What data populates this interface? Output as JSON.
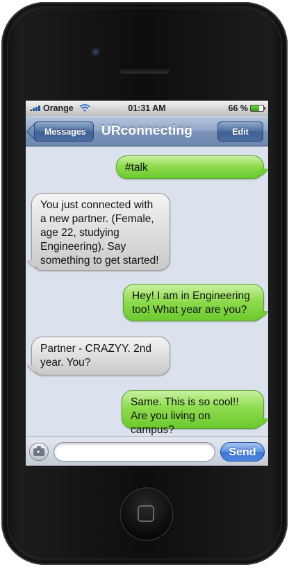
{
  "status_bar": {
    "carrier": "Orange",
    "time": "01:31 AM",
    "battery_percent": "66 %",
    "battery_level": 0.66,
    "signal_bars": 4
  },
  "nav_bar": {
    "back_label": "Messages",
    "title": "URconnecting",
    "edit_label": "Edit"
  },
  "messages": [
    {
      "direction": "out",
      "text": "#talk"
    },
    {
      "direction": "in",
      "text": "You just connected with a new partner. (Female, age 22, studying Engineering). Say something to get started!"
    },
    {
      "direction": "out",
      "text": "Hey! I am in Engineering too! What year are you?"
    },
    {
      "direction": "in",
      "text": "Partner - CRAZYY. 2nd year. You?"
    },
    {
      "direction": "out",
      "text": "Same. This is so cool!! Are you living on campus?"
    }
  ],
  "input_bar": {
    "placeholder": "",
    "send_label": "Send"
  },
  "colors": {
    "outgoing_bubble": "#8fdc4f",
    "incoming_bubble": "#dcdcdc",
    "nav_bar": "#7b93b8",
    "send_button": "#4c86e0"
  },
  "icons": {
    "camera": "camera-icon",
    "wifi": "wifi-icon",
    "battery": "battery-icon",
    "signal": "signal-bars-icon"
  }
}
